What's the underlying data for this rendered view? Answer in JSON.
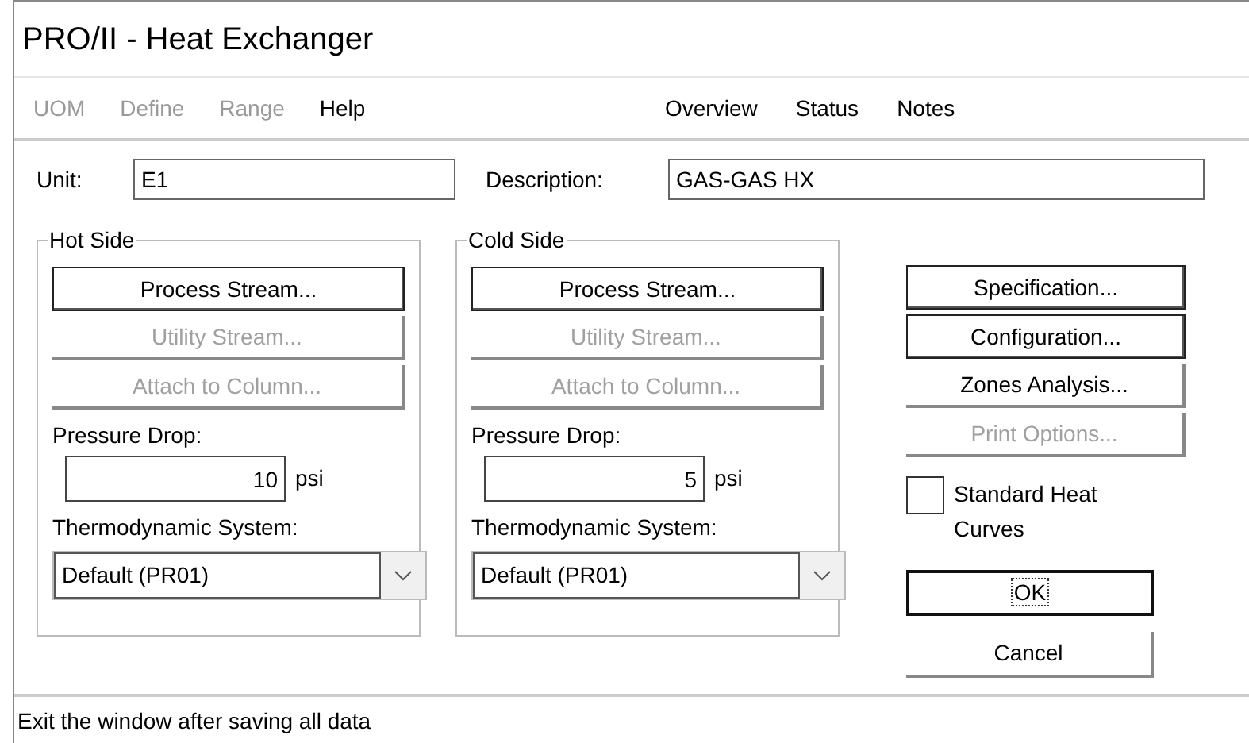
{
  "window": {
    "title": "PRO/II - Heat Exchanger"
  },
  "menu": [
    {
      "label": "UOM",
      "disabled": true
    },
    {
      "label": "Define",
      "disabled": true
    },
    {
      "label": "Range",
      "disabled": true
    },
    {
      "label": "Help",
      "disabled": false
    }
  ],
  "tabs": [
    {
      "label": "Overview"
    },
    {
      "label": "Status"
    },
    {
      "label": "Notes"
    }
  ],
  "unit": {
    "label": "Unit:",
    "value": "E1"
  },
  "description": {
    "label": "Description:",
    "value": "GAS-GAS HX"
  },
  "sides": [
    {
      "title": "Hot Side",
      "buttons": [
        {
          "label": "Process Stream...",
          "disabled": false,
          "framed": true
        },
        {
          "label": "Utility Stream...",
          "disabled": true,
          "framed": false
        },
        {
          "label": "Attach to Column...",
          "disabled": true,
          "framed": false
        }
      ],
      "pressure_label": "Pressure Drop:",
      "pressure_value": "10",
      "pressure_unit": "psi",
      "thermo_label": "Thermodynamic System:",
      "thermo_value": "Default (PR01)"
    },
    {
      "title": "Cold Side",
      "buttons": [
        {
          "label": "Process Stream...",
          "disabled": false,
          "framed": true
        },
        {
          "label": "Utility Stream...",
          "disabled": true,
          "framed": false
        },
        {
          "label": "Attach to Column...",
          "disabled": true,
          "framed": false
        }
      ],
      "pressure_label": "Pressure Drop:",
      "pressure_value": "5",
      "pressure_unit": "psi",
      "thermo_label": "Thermodynamic System:",
      "thermo_value": "Default (PR01)"
    }
  ],
  "actions": [
    {
      "label": "Specification...",
      "disabled": false,
      "framed": true
    },
    {
      "label": "Configuration...",
      "disabled": false,
      "framed": true
    },
    {
      "label": "Zones Analysis...",
      "disabled": false,
      "framed": false
    },
    {
      "label": "Print Options...",
      "disabled": true,
      "framed": false
    }
  ],
  "standard_heat_curves": {
    "label": "Standard Heat Curves",
    "checked": false
  },
  "dialog_buttons": [
    {
      "label": "OK",
      "framed": true,
      "focused": true
    },
    {
      "label": "Cancel",
      "framed": false,
      "focused": false
    }
  ],
  "status_bar": "Exit the window after saving all data"
}
